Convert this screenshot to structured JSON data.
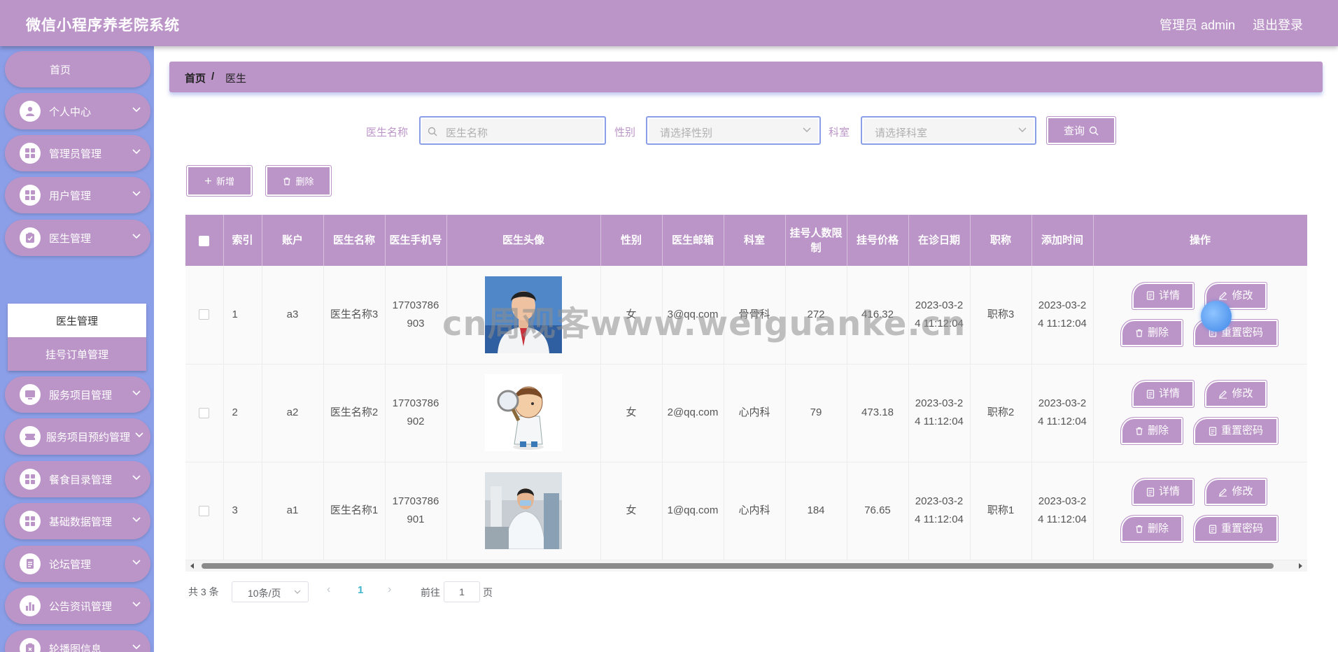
{
  "header": {
    "app_title": "微信小程序养老院系统",
    "user_info": "管理员 admin",
    "logout_label": "退出登录"
  },
  "sidebar": {
    "items": [
      {
        "label": "首页",
        "icon": "home-icon"
      },
      {
        "label": "个人中心",
        "icon": "user-icon"
      },
      {
        "label": "管理员管理",
        "icon": "grid-icon"
      },
      {
        "label": "用户管理",
        "icon": "grid-icon"
      },
      {
        "label": "医生管理",
        "icon": "clipboard-icon"
      },
      {
        "label": "服务项目管理",
        "icon": "monitor-icon"
      },
      {
        "label": "服务项目预约管理",
        "icon": "ticket-icon"
      },
      {
        "label": "餐食目录管理",
        "icon": "grid-icon"
      },
      {
        "label": "基础数据管理",
        "icon": "grid-icon"
      },
      {
        "label": "论坛管理",
        "icon": "document-icon"
      },
      {
        "label": "公告资讯管理",
        "icon": "chart-icon"
      },
      {
        "label": "轮播图信息",
        "icon": "clipboard-icon"
      }
    ],
    "submenu": {
      "active": "医生管理",
      "other": "挂号订单管理"
    }
  },
  "breadcrumb": {
    "home": "首页",
    "separator": "/",
    "current": "医生"
  },
  "search": {
    "name_label": "医生名称",
    "name_placeholder": "医生名称",
    "gender_label": "性别",
    "gender_placeholder": "请选择性别",
    "dept_label": "科室",
    "dept_placeholder": "请选择科室",
    "query_label": "查询"
  },
  "actions": {
    "add_label": "新增",
    "delete_label": "删除"
  },
  "table": {
    "columns": [
      "",
      "索引",
      "账户",
      "医生名称",
      "医生手机号",
      "医生头像",
      "性别",
      "医生邮箱",
      "科室",
      "挂号人数限制",
      "挂号价格",
      "在诊日期",
      "职称",
      "添加时间",
      "操作"
    ],
    "rows": [
      {
        "index": "1",
        "account": "a3",
        "name": "医生名称3",
        "phone": "17703786903",
        "gender": "女",
        "email": "3@qq.com",
        "dept": "骨骨科",
        "limit": "272",
        "price": "416.32",
        "date": "2023-03-24 11:12:04",
        "title": "职称3",
        "added": "2023-03-24 11:12:04"
      },
      {
        "index": "2",
        "account": "a2",
        "name": "医生名称2",
        "phone": "17703786902",
        "gender": "女",
        "email": "2@qq.com",
        "dept": "心内科",
        "limit": "79",
        "price": "473.18",
        "date": "2023-03-24 11:12:04",
        "title": "职称2",
        "added": "2023-03-24 11:12:04"
      },
      {
        "index": "3",
        "account": "a1",
        "name": "医生名称1",
        "phone": "17703786901",
        "gender": "女",
        "email": "1@qq.com",
        "dept": "心内科",
        "limit": "184",
        "price": "76.65",
        "date": "2023-03-24 11:12:04",
        "title": "职称1",
        "added": "2023-03-24 11:12:04"
      }
    ],
    "op_labels": {
      "detail": "详情",
      "edit": "修改",
      "delete": "删除",
      "reset": "重置密码"
    }
  },
  "pagination": {
    "total": "共 3 条",
    "page_size": "10条/页",
    "current_page": "1",
    "goto_label": "前往",
    "goto_value": "1",
    "page_suffix": "页"
  },
  "watermark": "cn周观客www.weiguanke.cn",
  "colors": {
    "primary": "#bc95c8",
    "sidebar_bg": "#8b9ee8",
    "active_page": "#3fb6c9"
  }
}
